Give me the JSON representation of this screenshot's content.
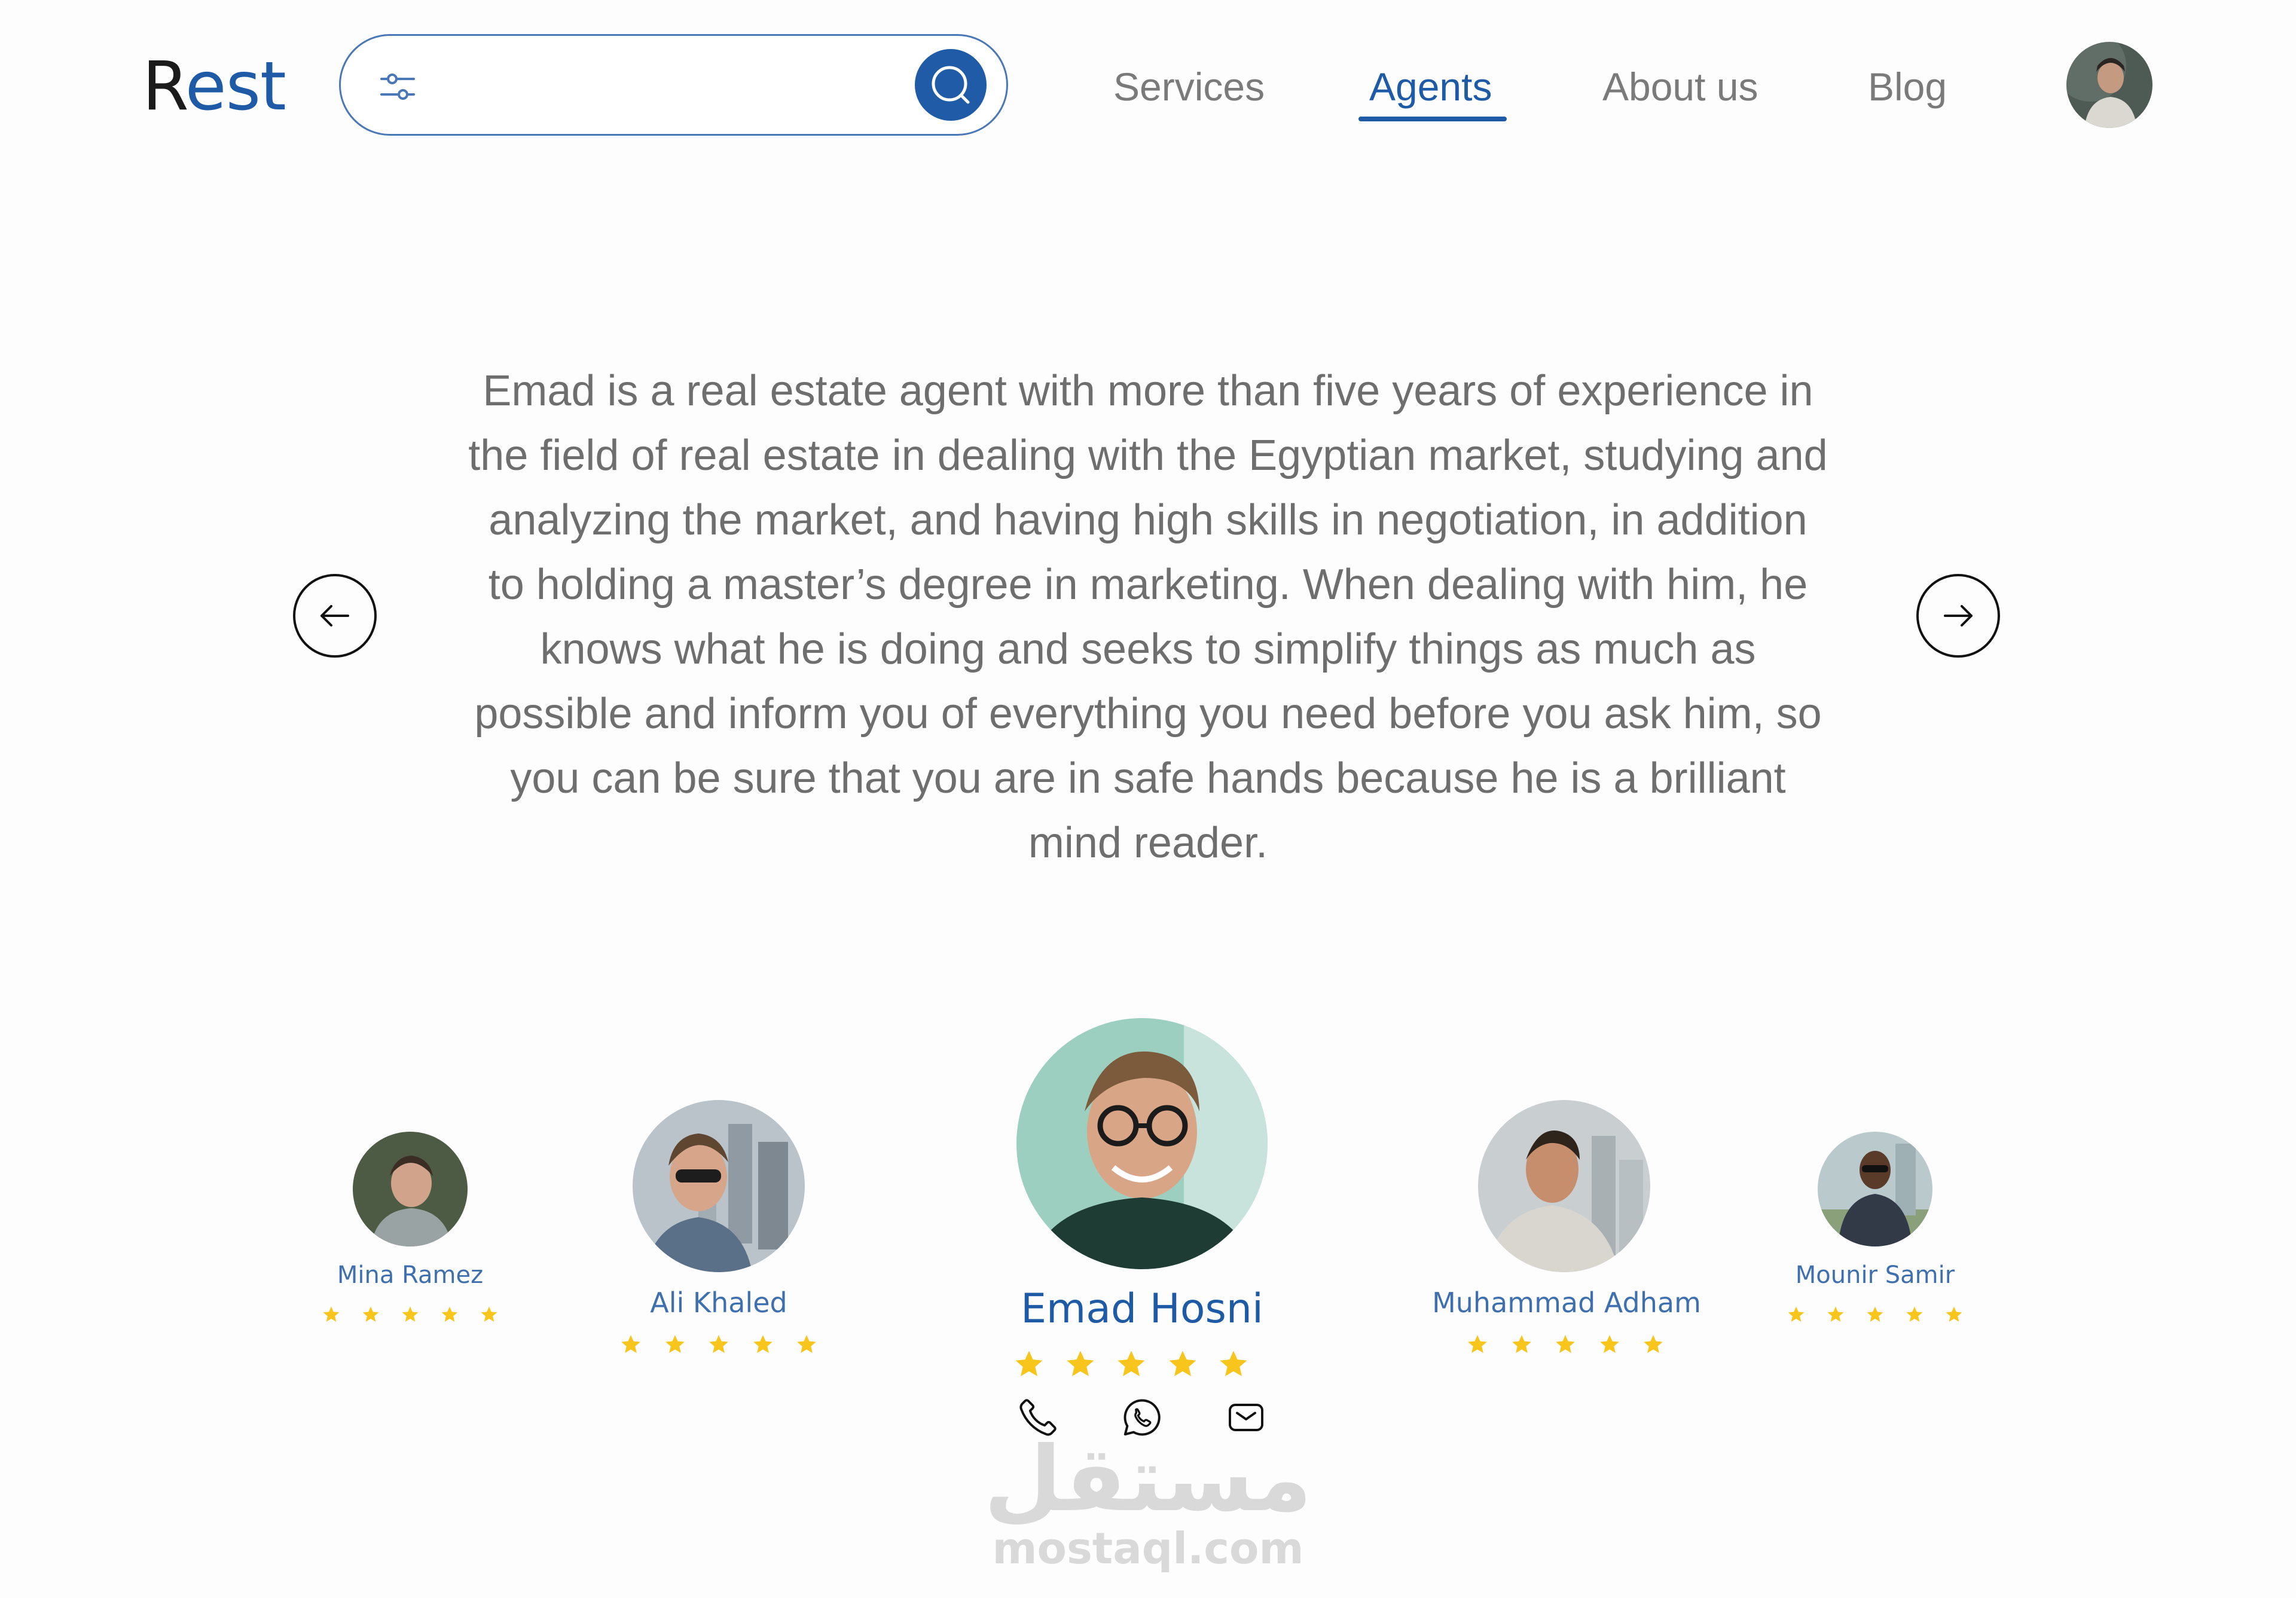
{
  "header": {
    "logo_first": "R",
    "logo_rest": "est",
    "search": {
      "placeholder": "",
      "value": ""
    },
    "nav": [
      {
        "label": "Services",
        "active": false
      },
      {
        "label": "Agents",
        "active": true
      },
      {
        "label": "About us",
        "active": false
      },
      {
        "label": "Blog",
        "active": false
      }
    ]
  },
  "description": "Emad is a real estate agent with more than five years of experience in the field of real estate in dealing with the Egyptian market, studying and analyzing the market, and having high skills in negotiation, in addition to holding a master’s degree in marketing. When dealing with him, he knows what he is doing and seeks to simplify things as much as possible and inform you of everything you need before you ask him, so you can be sure that you are in safe hands because he is a brilliant mind reader.",
  "agents": [
    {
      "name": "Mina Ramez",
      "rating": 5
    },
    {
      "name": "Ali Khaled",
      "rating": 5
    },
    {
      "name": "Emad Hosni",
      "rating": 5,
      "selected": true
    },
    {
      "name": "Muhammad Adham",
      "rating": 5
    },
    {
      "name": "Mounir Samir",
      "rating": 5
    }
  ],
  "contact_icons": [
    "phone-icon",
    "whatsapp-icon",
    "mail-icon"
  ],
  "colors": {
    "brand": "#1e5aa6",
    "name": "#3e6fae",
    "star": "#f7c51b",
    "text": "#6e6e6e"
  },
  "watermark": {
    "arabic": "مستقل",
    "latin": "mostaql.com"
  }
}
